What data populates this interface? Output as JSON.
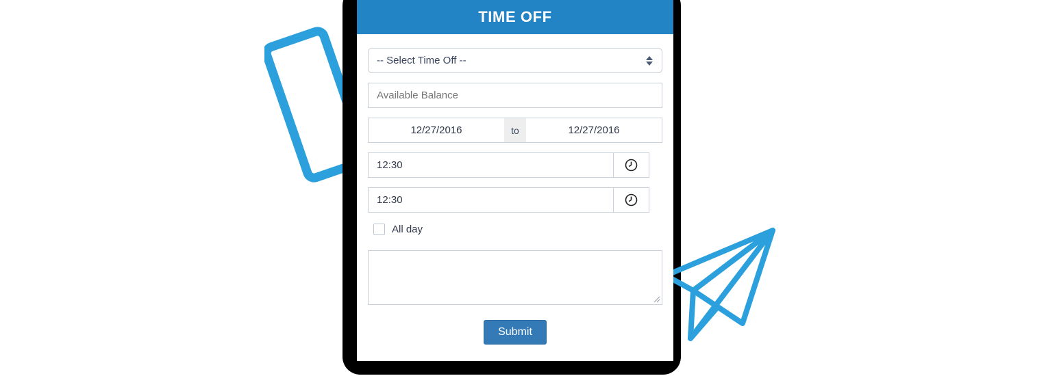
{
  "theme": {
    "header_blue": "#2283c5",
    "submit_blue": "#337ab7",
    "artwork_blue": "#2ba0dd",
    "frame_black": "#000000",
    "border_grey": "#c8d0dc",
    "separator_grey": "#eeeeee",
    "placeholder_grey": "#b0b4b9",
    "text_navy": "#30384a"
  },
  "panel": {
    "title": "TIME OFF"
  },
  "form": {
    "timeoff_select": {
      "selected": "-- Select Time Off --",
      "spinner_icon": "spinner-updown-icon"
    },
    "balance": {
      "value": "",
      "placeholder": "Available Balance"
    },
    "date_range": {
      "start": "12/27/2016",
      "separator": "to",
      "end": "12/27/2016"
    },
    "start_time": {
      "value": "12:30",
      "addon_icon": "clock-icon"
    },
    "end_time": {
      "value": "12:30",
      "addon_icon": "clock-icon"
    },
    "all_day": {
      "label": "All day",
      "checked": false
    },
    "notes": {
      "value": "",
      "placeholder": "",
      "grip_icon": "resize-grip-icon"
    },
    "submit_label": "Submit"
  },
  "artwork": {
    "phone_icon": "smartphone-icon",
    "plane_icon": "paper-plane-icon"
  }
}
